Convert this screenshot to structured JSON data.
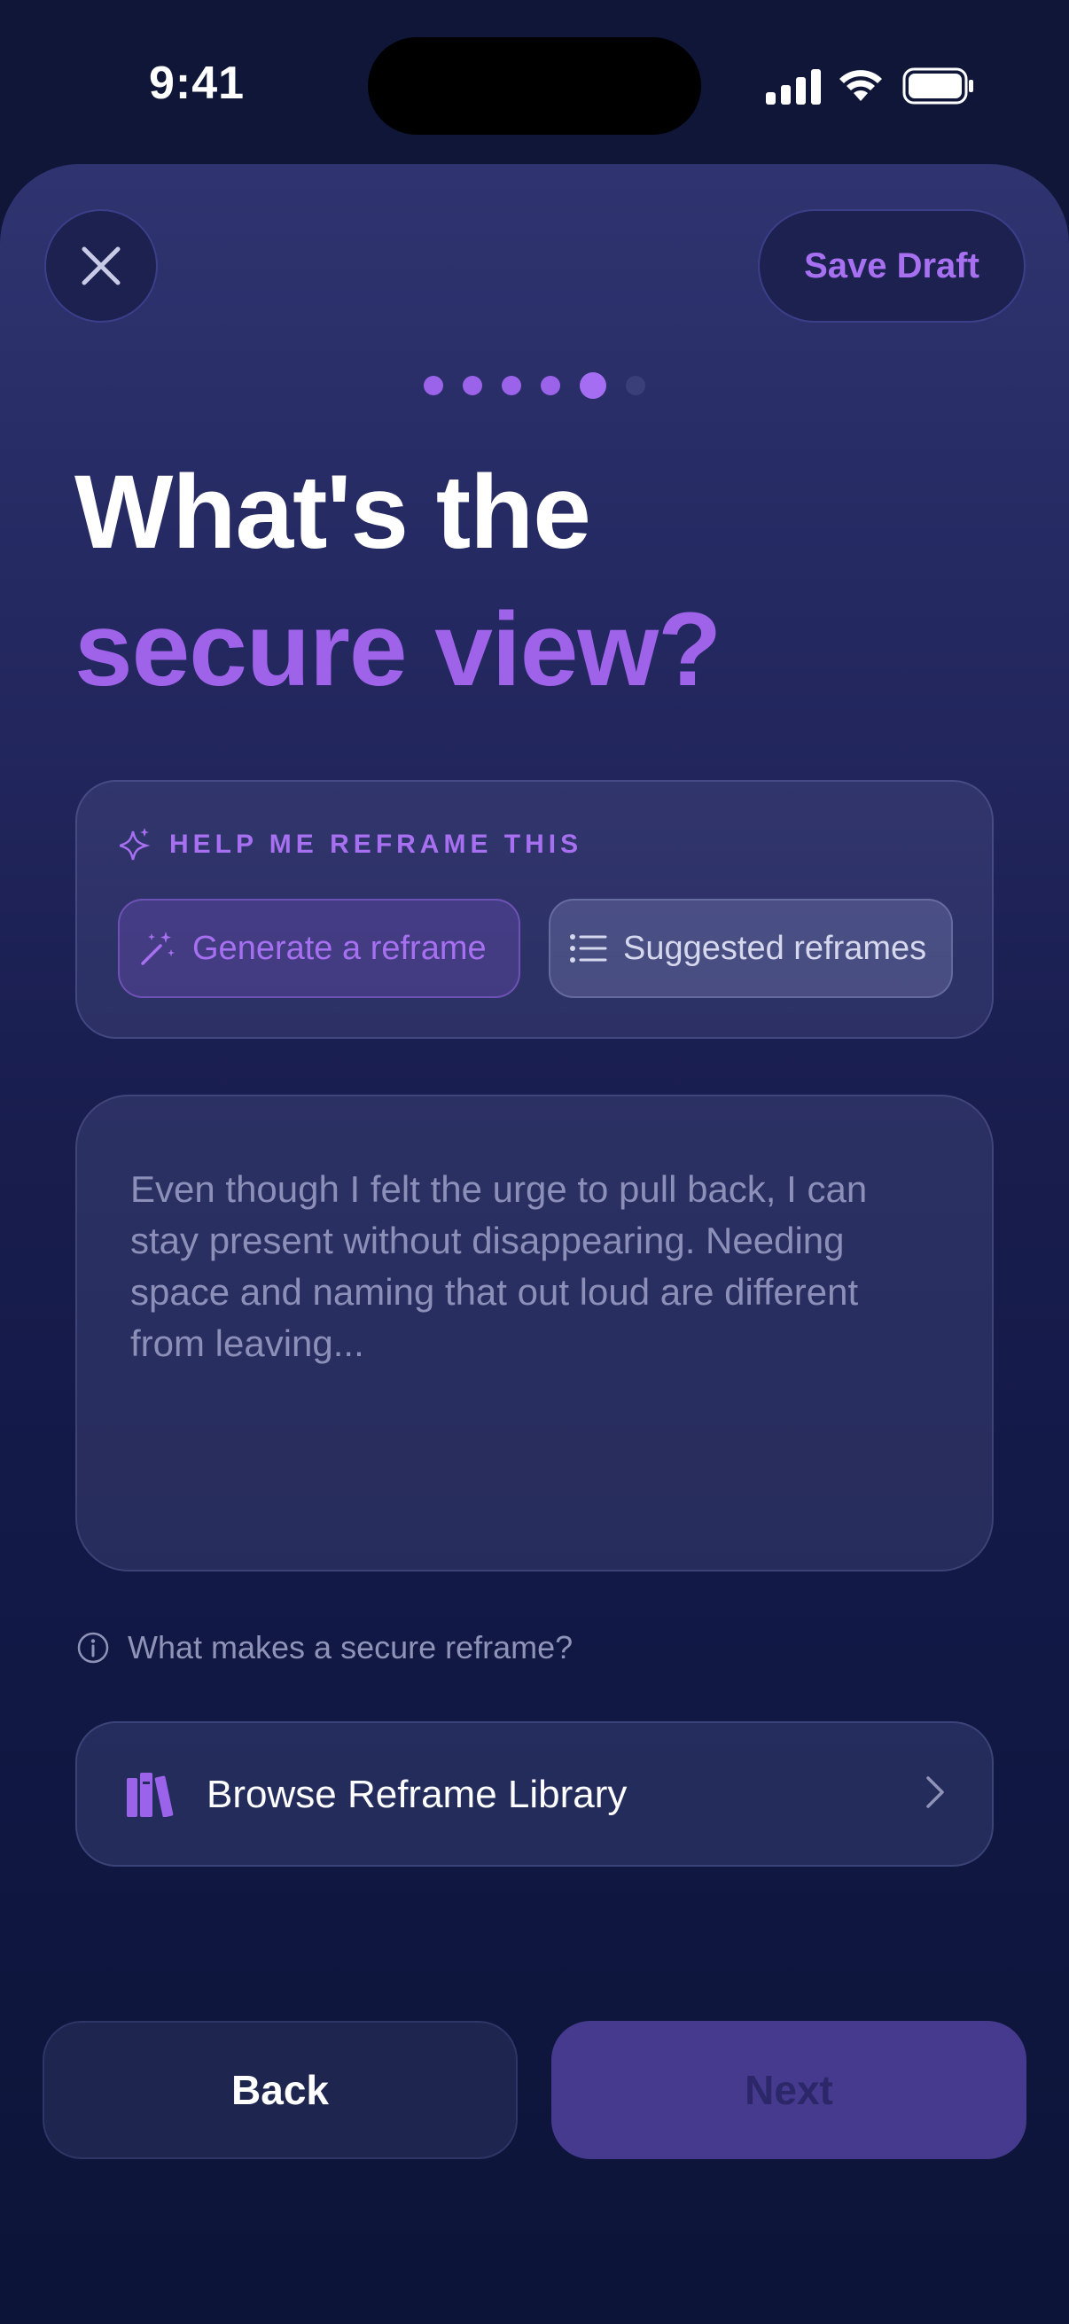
{
  "status_bar": {
    "time": "9:41"
  },
  "header": {
    "save_draft_label": "Save Draft"
  },
  "progress": {
    "total_steps": 6,
    "current_step": 5
  },
  "title": {
    "line1": "What's the",
    "line2": "secure view?"
  },
  "help": {
    "heading": "HELP ME REFRAME THIS",
    "generate_label": "Generate a reframe",
    "suggested_label": "Suggested reframes"
  },
  "reframe_input": {
    "value": "",
    "placeholder": "Even though I felt the urge to pull back, I can stay present without disappearing. Needing space and naming that out loud are different from leaving..."
  },
  "info_link": {
    "label": "What makes a secure reframe?"
  },
  "library": {
    "label": "Browse Reframe Library"
  },
  "footer": {
    "back_label": "Back",
    "next_label": "Next"
  },
  "colors": {
    "accent": "#A670F0",
    "background": "#0F1638",
    "next_disabled": "#463A8E"
  }
}
